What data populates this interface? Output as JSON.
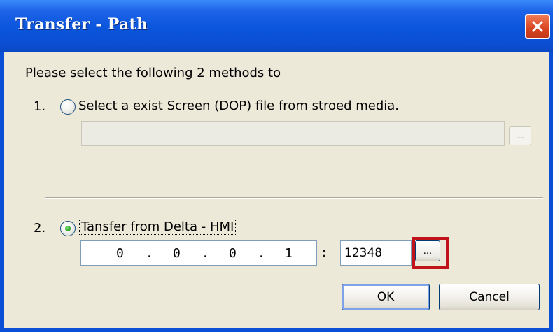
{
  "window": {
    "title": "Transfer - Path"
  },
  "dialog": {
    "instruction": "Please select the following 2 methods to",
    "option1": {
      "number": "1.",
      "label": "Select a exist  Screen (DOP) file from stroed media.",
      "selected": false,
      "path_value": "",
      "browse_label": "..."
    },
    "option2": {
      "number": "2.",
      "label": "Tansfer from Delta - HMI",
      "selected": true,
      "ip": {
        "octet1": "0",
        "dot1": ".",
        "octet2": "0",
        "dot2": ".",
        "octet3": "0",
        "dot3": ".",
        "octet4": "1"
      },
      "port_separator": ":",
      "port": "12348",
      "browse_label": "..."
    },
    "ok_label": "OK",
    "cancel_label": "Cancel"
  },
  "colors": {
    "titlebar": "#0a55dc",
    "client_bg": "#ece9d8",
    "highlight": "#c0141a",
    "radio_selected": "#2ea52a"
  }
}
